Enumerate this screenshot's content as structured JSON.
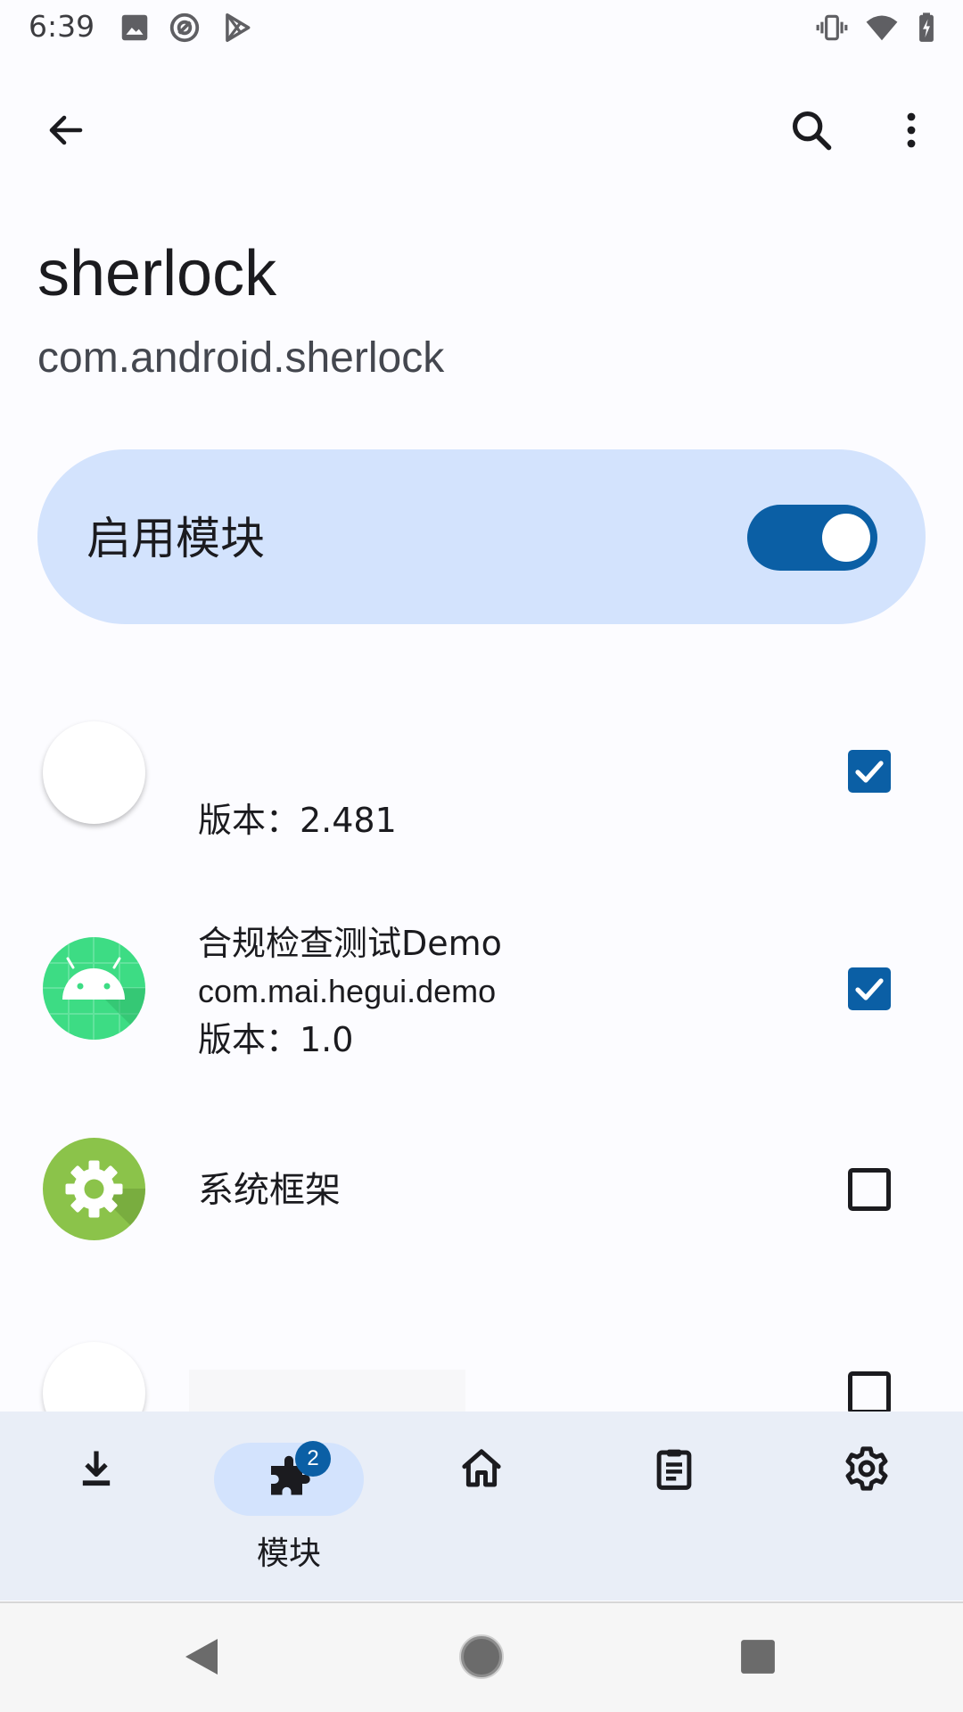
{
  "status_bar": {
    "time": "6:39",
    "left_icons": [
      "image-icon",
      "at-sign-icon",
      "play-store-icon"
    ],
    "right_icons": [
      "vibrate-icon",
      "wifi-icon",
      "battery-charging-icon"
    ]
  },
  "app_bar": {
    "back_icon": "back-arrow-icon",
    "search_icon": "search-icon",
    "more_icon": "more-vert-icon"
  },
  "header": {
    "app_name": "sherlock",
    "package_name": "com.android.sherlock"
  },
  "enable_card": {
    "label": "启用模块",
    "enabled": true
  },
  "scope_list": [
    {
      "title": "",
      "package": "",
      "version": "版本：2.481",
      "checked": true
    },
    {
      "title": "合规检查测试Demo",
      "package": "com.mai.hegui.demo",
      "version": "版本：1.0",
      "checked": true
    },
    {
      "title": "系统框架",
      "package": "",
      "version": "",
      "checked": false
    },
    {
      "title": "",
      "package": "",
      "version": "",
      "checked": false
    }
  ],
  "bottom_nav": {
    "items": [
      {
        "icon": "download-icon",
        "label": ""
      },
      {
        "icon": "puzzle-icon",
        "label": "模块",
        "badge": "2",
        "active": true
      },
      {
        "icon": "home-icon",
        "label": ""
      },
      {
        "icon": "clipboard-icon",
        "label": ""
      },
      {
        "icon": "gear-icon",
        "label": ""
      }
    ]
  },
  "colors": {
    "accent": "#0b5fa5",
    "card_bg": "#d3e3fd",
    "nav_bg": "#e9eef7",
    "page_bg": "#fcfcff"
  }
}
